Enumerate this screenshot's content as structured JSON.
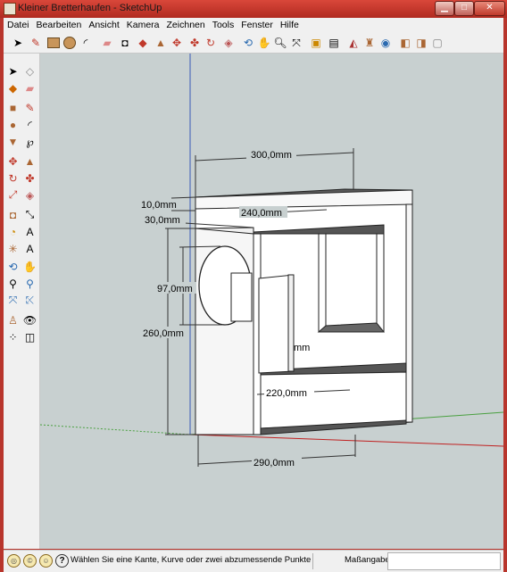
{
  "window": {
    "title": "Kleiner Bretterhaufen - SketchUp"
  },
  "menu": [
    "Datei",
    "Bearbeiten",
    "Ansicht",
    "Kamera",
    "Zeichnen",
    "Tools",
    "Fenster",
    "Hilfe"
  ],
  "toolbar_icons": [
    "select-icon",
    "pencil-icon",
    "rectangle-icon",
    "circle-icon",
    "arc-icon",
    "eraser-icon",
    "paint-bucket-icon",
    "push-pull-icon",
    "move-icon",
    "rotate-icon",
    "follow-me-icon",
    "scale-icon",
    "offset-icon",
    "orbit-icon",
    "pan-icon",
    "zoom-icon",
    "zoom-extents-icon",
    "model-info-icon",
    "components-icon",
    "materials-icon",
    "3d-warehouse-icon",
    "get-models-icon",
    "share-model-icon",
    "layers-icon"
  ],
  "dimensions": {
    "top_width": "300,0mm",
    "inner_width_top": "240,0mm",
    "top_thickness": "10,0mm",
    "second_offset": "30,0mm",
    "hole_diameter": "97,0mm",
    "height": "260,0mm",
    "partial": "mm",
    "inner_width_low": "220,0mm",
    "bottom_width": "290,0mm"
  },
  "status": {
    "message": "Wählen Sie eine Kante, Kurve oder zwei abzumessende Punkte aus oder ziel",
    "measurements_label": "Maßangaben",
    "measurements_value": ""
  },
  "colors": {
    "titlebar": "#c0392b",
    "viewport": "#c8d0d0",
    "model_face": "#f4f4f4",
    "shelf_dark": "#555555"
  }
}
